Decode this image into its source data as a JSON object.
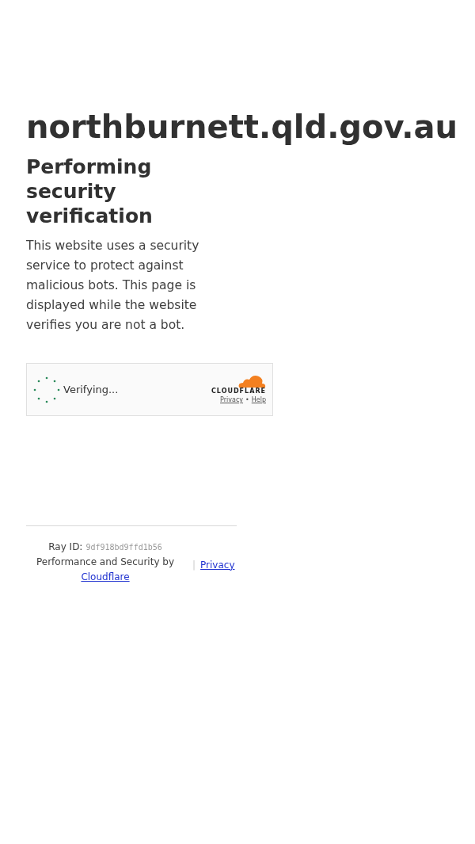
{
  "domain": "northburnett.qld.gov.au",
  "heading": "Performing security verification",
  "description": "This website uses a security service to protect against malicious bots. This page is displayed while the website verifies you are not a bot.",
  "widget": {
    "status": "Verifying...",
    "logo": "CLOUDFLARE",
    "links": [
      "Privacy",
      "Help"
    ],
    "separator": "•"
  },
  "footer": {
    "ray_label": "Ray ID:",
    "ray_id": "9df918bd9ffd1b56",
    "performance": "Performance and Security by",
    "provider_link": "Cloudflare",
    "divider": "|",
    "privacy_link": "Privacy"
  }
}
